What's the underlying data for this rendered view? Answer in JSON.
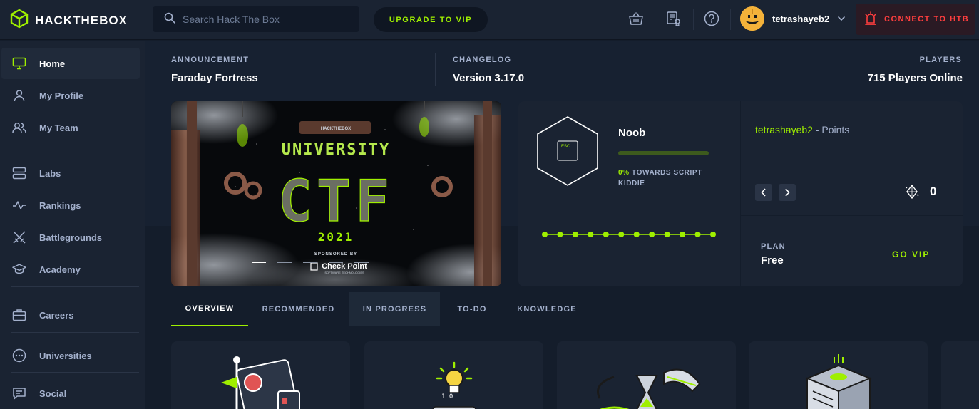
{
  "header": {
    "brand": "HACKTHEBOX",
    "search_placeholder": "Search Hack The Box",
    "upgrade_label": "UPGRADE TO VIP",
    "username": "tetrashayeb2",
    "connect_label": "CONNECT TO HTB"
  },
  "sidebar": {
    "items": [
      {
        "label": "Home",
        "icon": "monitor-icon"
      },
      {
        "label": "My Profile",
        "icon": "user-icon"
      },
      {
        "label": "My Team",
        "icon": "users-icon"
      },
      {
        "label": "Labs",
        "icon": "server-icon"
      },
      {
        "label": "Rankings",
        "icon": "pulse-icon"
      },
      {
        "label": "Battlegrounds",
        "icon": "swords-icon"
      },
      {
        "label": "Academy",
        "icon": "graduation-cap-icon"
      },
      {
        "label": "Careers",
        "icon": "briefcase-icon"
      },
      {
        "label": "Universities",
        "icon": "dots-circle-icon"
      },
      {
        "label": "Social",
        "icon": "chat-icon"
      }
    ]
  },
  "stats": {
    "announcement_label": "ANNOUNCEMENT",
    "announcement_value": "Faraday Fortress",
    "changelog_label": "CHANGELOG",
    "changelog_value": "Version 3.17.0",
    "players_label": "PLAYERS",
    "players_count": "715",
    "players_suffix": "Players Online"
  },
  "banner": {
    "brand": "HACKTHEBOX",
    "title_top": "UNIVERSITY",
    "title_main": "CTF",
    "year": "2021",
    "sponsored_by": "SPONSORED BY",
    "sponsor": "Check Point",
    "sponsor_sub": "SOFTWARE TECHNOLOGIES",
    "slide_count": 5,
    "active_slide": 1
  },
  "rank": {
    "badge_text": "ESC",
    "title": "Noob",
    "progress_percent": "0%",
    "progress_text": "TOWARDS SCRIPT KIDDIE",
    "progress_fraction": 0.0,
    "dot_count": 12
  },
  "points": {
    "username": "tetrashayeb2",
    "suffix": " - Points",
    "value": "0",
    "plan_label": "PLAN",
    "plan_value": "Free",
    "go_vip": "GO VIP"
  },
  "tabs": [
    {
      "label": "OVERVIEW"
    },
    {
      "label": "RECOMMENDED"
    },
    {
      "label": "IN PROGRESS"
    },
    {
      "label": "TO-DO"
    },
    {
      "label": "KNOWLEDGE"
    }
  ],
  "colors": {
    "accent": "#9fef00",
    "danger": "#ff3e3e",
    "background": "#141d2b",
    "panel": "#1a2332"
  }
}
